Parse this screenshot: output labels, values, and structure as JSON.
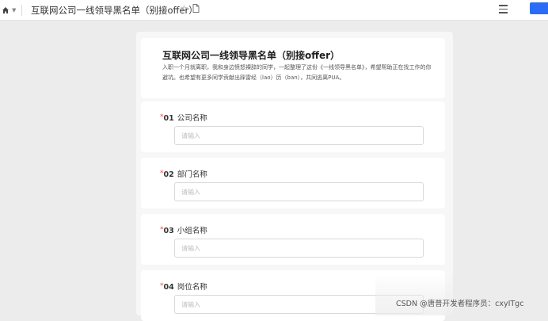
{
  "toolbar": {
    "title": "互联网公司一线领导黑名单（别接offer）",
    "home_icon": "home-icon",
    "caret_icon": "chevron-down-icon",
    "star_icon": "star-icon",
    "file_icon": "file-icon",
    "menu_icon": "menu-icon",
    "accent_color": "#2b6cf6"
  },
  "form": {
    "title": "互联网公司一线领导黑名单（别接offer）",
    "description": "入职一个月就离职，我和身边愤怒裸辞的同学，一起整理了这份《一线领导黑名单》，希望帮助正在找工作的你避坑。也希望有更多同学贡献出踩雷经（lao）历（ban），共同逃离PUA。",
    "required_mark": "*",
    "questions": [
      {
        "number": "01",
        "label": "公司名称",
        "placeholder": "请输入"
      },
      {
        "number": "02",
        "label": "部门名称",
        "placeholder": "请输入"
      },
      {
        "number": "03",
        "label": "小组名称",
        "placeholder": "请输入"
      },
      {
        "number": "04",
        "label": "岗位名称",
        "placeholder": "请输入"
      }
    ]
  },
  "watermark": "CSDN @唐普开发者程序员：cxyITgc"
}
